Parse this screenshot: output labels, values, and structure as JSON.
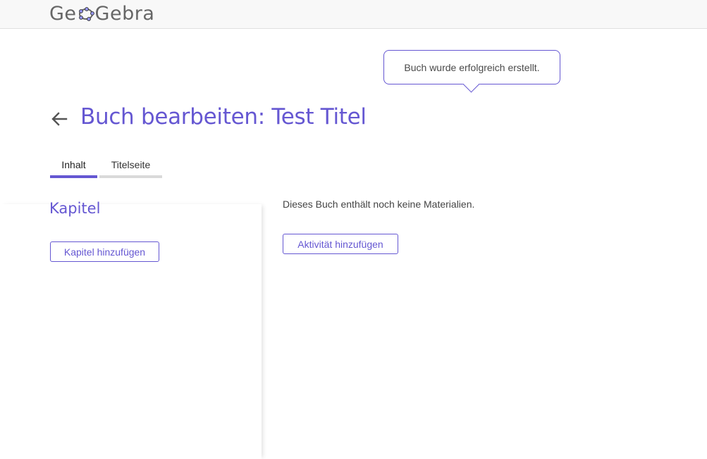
{
  "header": {
    "logo_text_left": "Ge",
    "logo_text_right": "Gebra",
    "logo_icon": "geogebra-logo-icon"
  },
  "toast": {
    "message": "Buch wurde erfolgreich erstellt."
  },
  "page": {
    "back_icon": "arrow-left-icon",
    "title": "Buch bearbeiten: Test Titel"
  },
  "tabs": [
    {
      "label": "Inhalt",
      "active": true
    },
    {
      "label": "Titelseite",
      "active": false
    }
  ],
  "sidebar": {
    "title": "Kapitel",
    "add_chapter_label": "Kapitel hinzufügen"
  },
  "main": {
    "empty_message": "Dieses Buch enthält noch keine Materialien.",
    "add_activity_label": "Aktivität hinzufügen"
  },
  "colors": {
    "accent": "#6557d2",
    "topbar_bg": "#f8f8f8",
    "tab_inactive": "#d9d9d9"
  }
}
